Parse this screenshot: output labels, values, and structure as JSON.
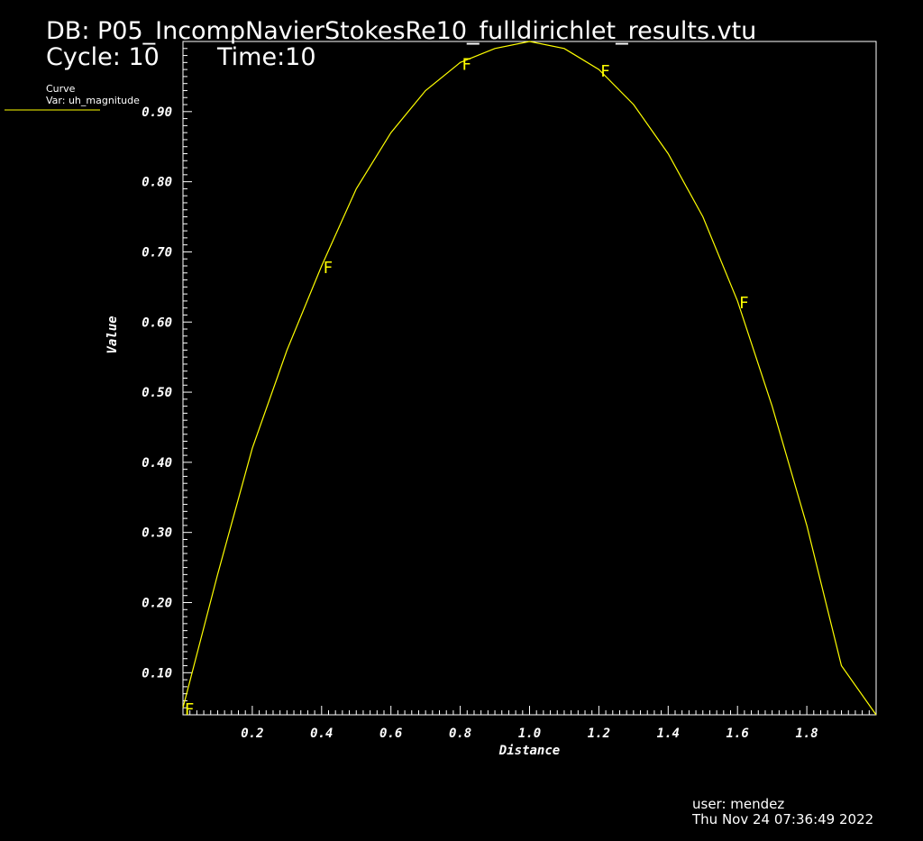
{
  "header": {
    "db": "DB: P05_IncompNavierStokesRe10_fulldirichlet_results.vtu",
    "cycle": "Cycle: 10",
    "time": "Time:10"
  },
  "legend": {
    "title": "Curve",
    "var": "Var: uh_magnitude"
  },
  "footer": {
    "user": "user: mendez",
    "date": "Thu Nov 24 07:36:49 2022"
  },
  "colors": {
    "background": "#000000",
    "curve": "#ffff00",
    "axes": "#ffffff"
  },
  "chart_data": {
    "type": "line",
    "xlabel": "Distance",
    "ylabel": "Value",
    "xlim": [
      0.0,
      2.0
    ],
    "ylim": [
      0.04,
      1.0
    ],
    "xticks": [
      0.2,
      0.4,
      0.6,
      0.8,
      1.0,
      1.2,
      1.4,
      1.6,
      1.8
    ],
    "xtick_labels": [
      "0.2",
      "0.4",
      "0.6",
      "0.8",
      "1.0",
      "1.2",
      "1.4",
      "1.6",
      "1.8"
    ],
    "yticks": [
      0.1,
      0.2,
      0.3,
      0.4,
      0.5,
      0.6,
      0.7,
      0.8,
      0.9
    ],
    "ytick_labels": [
      "0.10",
      "0.20",
      "0.30",
      "0.40",
      "0.50",
      "0.60",
      "0.70",
      "0.80",
      "0.90"
    ],
    "grid": false,
    "series": [
      {
        "color": "#ffff00",
        "marker_label": "F",
        "x": [
          0.0,
          0.1,
          0.2,
          0.3,
          0.4,
          0.5,
          0.6,
          0.7,
          0.8,
          0.9,
          1.0,
          1.1,
          1.2,
          1.3,
          1.4,
          1.5,
          1.6,
          1.7,
          1.8,
          1.9,
          2.0
        ],
        "y": [
          0.05,
          0.24,
          0.42,
          0.56,
          0.68,
          0.79,
          0.87,
          0.93,
          0.97,
          0.99,
          1.0,
          0.99,
          0.96,
          0.91,
          0.84,
          0.75,
          0.63,
          0.48,
          0.31,
          0.11,
          0.04
        ],
        "marker_x": [
          0.0,
          0.4,
          0.8,
          1.2,
          1.6
        ]
      }
    ]
  }
}
